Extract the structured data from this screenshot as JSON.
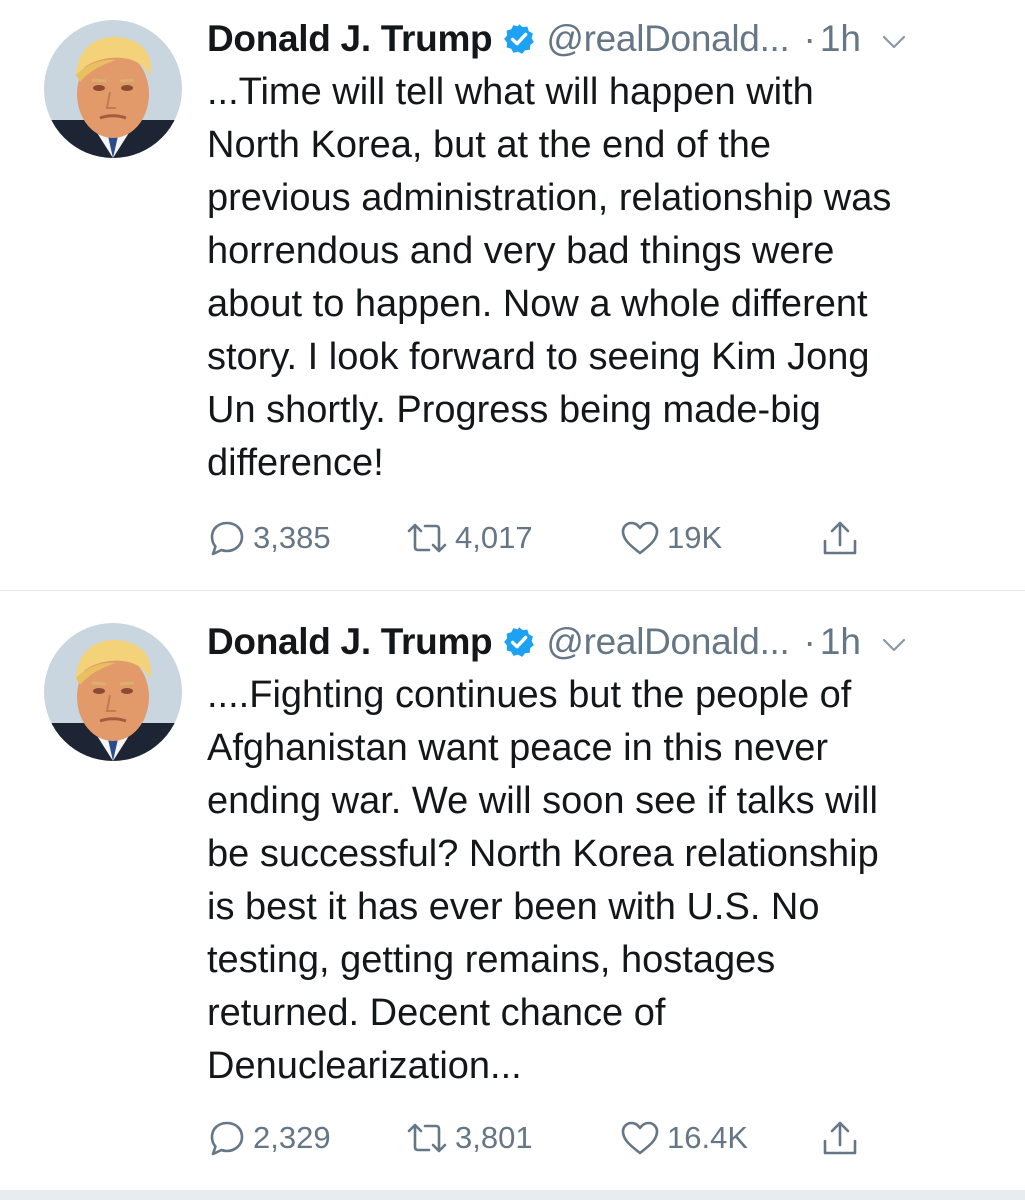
{
  "tweets": [
    {
      "author": {
        "name": "Donald J. Trump",
        "handle": "@realDonald...",
        "verified": true
      },
      "separator": "·",
      "time": "1h",
      "text": "...Time will tell what will happen with\nNorth Korea, but at the end of the\nprevious administration, relationship was\nhorrendous and very bad things were\nabout to happen. Now a whole different\nstory. I look forward to seeing Kim Jong\nUn shortly. Progress being made-big\ndifference!",
      "stats": {
        "replies": "3,385",
        "retweets": "4,017",
        "likes": "19K"
      }
    },
    {
      "author": {
        "name": "Donald J. Trump",
        "handle": "@realDonald...",
        "verified": true
      },
      "separator": "·",
      "time": "1h",
      "text": "....Fighting continues but the people of\nAfghanistan want peace in this never\nending war. We will soon see if talks will\nbe successful? North Korea relationship\nis best it has ever been with U.S. No\ntesting, getting remains, hostages\nreturned. Decent chance of\nDenuclearization...",
      "stats": {
        "replies": "2,329",
        "retweets": "3,801",
        "likes": "16.4K"
      }
    }
  ],
  "icons": {
    "verified": "verified-badge-icon",
    "chevron": "chevron-down-icon",
    "reply": "reply-bubble-icon",
    "retweet": "retweet-icon",
    "like": "heart-icon",
    "share": "share-icon"
  },
  "colors": {
    "text": "#14171a",
    "secondary": "#657786",
    "verified": "#1da1f2",
    "divider": "#e1e8ed"
  }
}
